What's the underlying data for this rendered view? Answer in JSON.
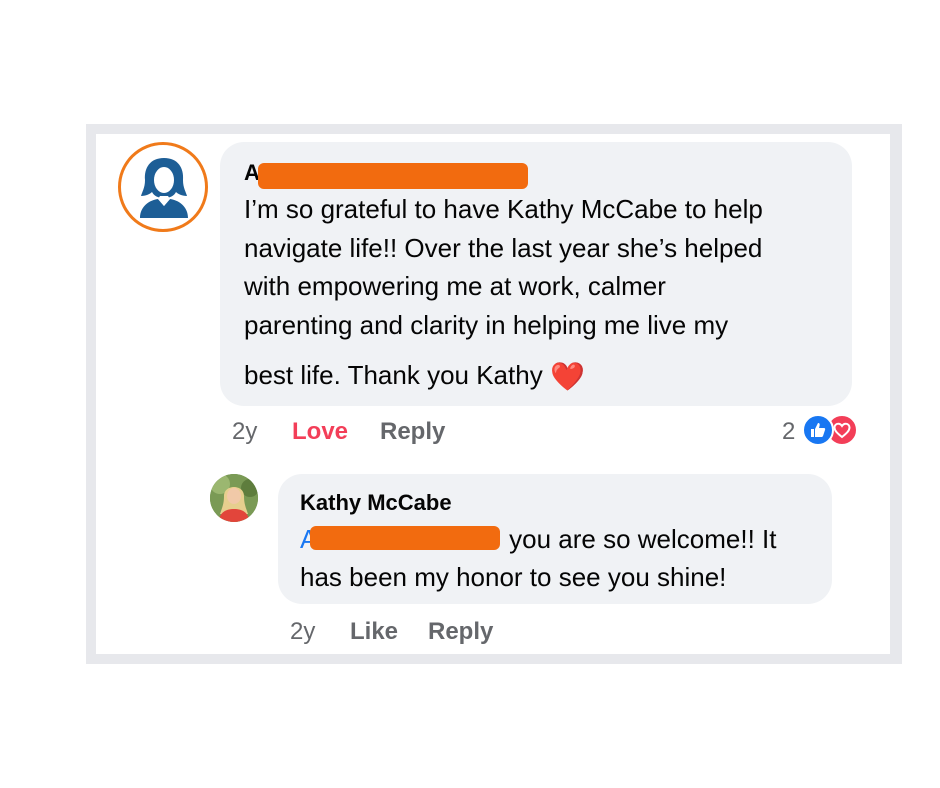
{
  "comment": {
    "author_initial": "A",
    "text_lines": [
      "I’m so grateful to have Kathy McCabe to help",
      "navigate life!! Over the last year she’s helped",
      "with empowering me at work, calmer",
      "parenting and clarity in helping me live my"
    ],
    "last_line": "best life. Thank you Kathy",
    "heart_emoji": "❤️",
    "time": "2y",
    "love_label": "Love",
    "reply_label": "Reply",
    "reaction_count": "2",
    "reaction_icons": [
      "like-icon",
      "love-icon"
    ]
  },
  "reply": {
    "author": "Kathy McCabe",
    "mention": "A",
    "line1_rest": "you are so welcome!! It",
    "line2": "has been my honor to see you shine!",
    "time": "2y",
    "like_label": "Like",
    "reply_label": "Reply"
  },
  "colors": {
    "redaction": "#f26b0f",
    "love": "#f33e58",
    "mention": "#1877f2",
    "avatar_ring": "#f07a1a",
    "avatar_figure": "#1d5e96"
  }
}
